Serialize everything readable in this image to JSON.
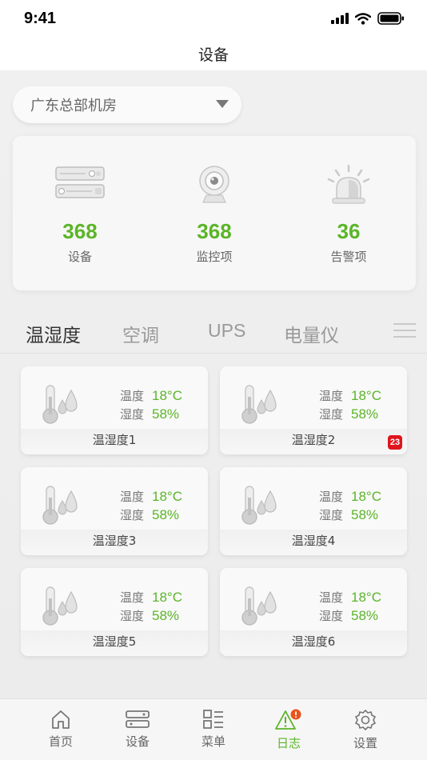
{
  "status_bar": {
    "time": "9:41"
  },
  "nav": {
    "title": "设备"
  },
  "location": {
    "value": "广东总部机房"
  },
  "stats": [
    {
      "icon": "server-rack-icon",
      "value": "368",
      "label": "设备"
    },
    {
      "icon": "webcam-icon",
      "value": "368",
      "label": "监控项"
    },
    {
      "icon": "alarm-light-icon",
      "value": "36",
      "label": "告警项"
    }
  ],
  "category_tabs": [
    {
      "label": "温湿度",
      "active": true
    },
    {
      "label": "空调",
      "active": false
    },
    {
      "label": "UPS",
      "active": false
    },
    {
      "label": "电量仪",
      "active": false
    }
  ],
  "sensors": [
    {
      "name": "温湿度1",
      "temp_label": "温度",
      "temp": "18°C",
      "hum_label": "湿度",
      "hum": "58%",
      "badge": null
    },
    {
      "name": "温湿度2",
      "temp_label": "温度",
      "temp": "18°C",
      "hum_label": "湿度",
      "hum": "58%",
      "badge": "23"
    },
    {
      "name": "温湿度3",
      "temp_label": "温度",
      "temp": "18°C",
      "hum_label": "湿度",
      "hum": "58%",
      "badge": null
    },
    {
      "name": "温湿度4",
      "temp_label": "温度",
      "temp": "18°C",
      "hum_label": "湿度",
      "hum": "58%",
      "badge": null
    },
    {
      "name": "温湿度5",
      "temp_label": "温度",
      "temp": "18°C",
      "hum_label": "湿度",
      "hum": "58%",
      "badge": null
    },
    {
      "name": "温湿度6",
      "temp_label": "温度",
      "temp": "18°C",
      "hum_label": "湿度",
      "hum": "58%",
      "badge": null
    }
  ],
  "bottom_tabs": [
    {
      "icon": "home-icon",
      "label": "首页",
      "active": false
    },
    {
      "icon": "device-icon",
      "label": "设备",
      "active": false
    },
    {
      "icon": "menu-grid-icon",
      "label": "菜单",
      "active": false
    },
    {
      "icon": "log-alert-icon",
      "label": "日志",
      "active": true
    },
    {
      "icon": "settings-gear-icon",
      "label": "设置",
      "active": false
    }
  ],
  "colors": {
    "accent": "#5bb528",
    "badge": "#e0141c",
    "alert_dot": "#e8541c"
  }
}
